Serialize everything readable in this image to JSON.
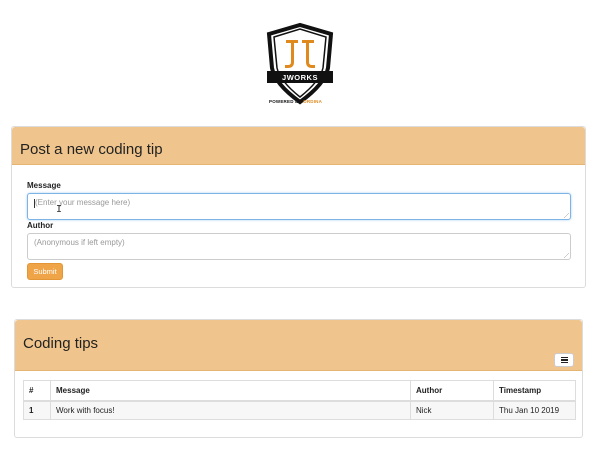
{
  "logo": {
    "wordmark": "JWORKS",
    "powered_by": "POWERED BY",
    "powered_brand": "ORDINA"
  },
  "post_form": {
    "title": "Post a new coding tip",
    "message_label": "Message",
    "message_placeholder": "(Enter your message here)",
    "author_label": "Author",
    "author_placeholder": "(Anonymous if left empty)",
    "submit_label": "Submit"
  },
  "tips": {
    "title": "Coding tips",
    "columns": [
      "#",
      "Message",
      "Author",
      "Timestamp"
    ],
    "rows": [
      {
        "num": "1",
        "message": "Work with focus!",
        "author": "Nick",
        "timestamp": "Thu Jan 10 2019"
      }
    ]
  },
  "colors": {
    "panel_heading": "#f0c58d",
    "submit": "#eea447",
    "logo_orange": "#e08a1e"
  },
  "icons": {
    "menu": "hamburger-icon"
  }
}
